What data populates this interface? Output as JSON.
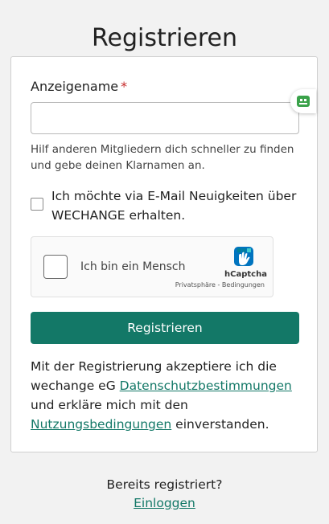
{
  "page": {
    "title": "Registrieren"
  },
  "form": {
    "display_name_label": "Anzeigename",
    "required_marker": "*",
    "display_name_value": "",
    "display_name_help": "Hilf anderen Mitgliedern dich schneller zu finden und gebe deinen Klarnamen an.",
    "newsletter_label": "Ich möchte via E-Mail Neuigkeiten über WECHANGE erhalten.",
    "newsletter_checked": false,
    "submit_label": "Registrieren"
  },
  "captcha": {
    "label": "Ich bin ein Mensch",
    "brand": "hCaptcha",
    "links": "Privatsphäre - Bedingungen"
  },
  "terms": {
    "part1": "Mit der Registrierung akzeptiere ich die wechange eG ",
    "privacy_link": "Datenschutzbestimmungen",
    "part2": " und erkläre mich mit den ",
    "terms_link": "Nutzungsbedingungen",
    "part3": " einverstanden."
  },
  "footer": {
    "already_registered": "Bereits registriert?",
    "login_link": "Einloggen"
  },
  "colors": {
    "accent": "#137867",
    "required": "#c62828",
    "password_manager": "#3aa24a"
  },
  "icons": {
    "password_manager": "password-manager-icon",
    "captcha_logo": "hcaptcha-logo-icon"
  }
}
